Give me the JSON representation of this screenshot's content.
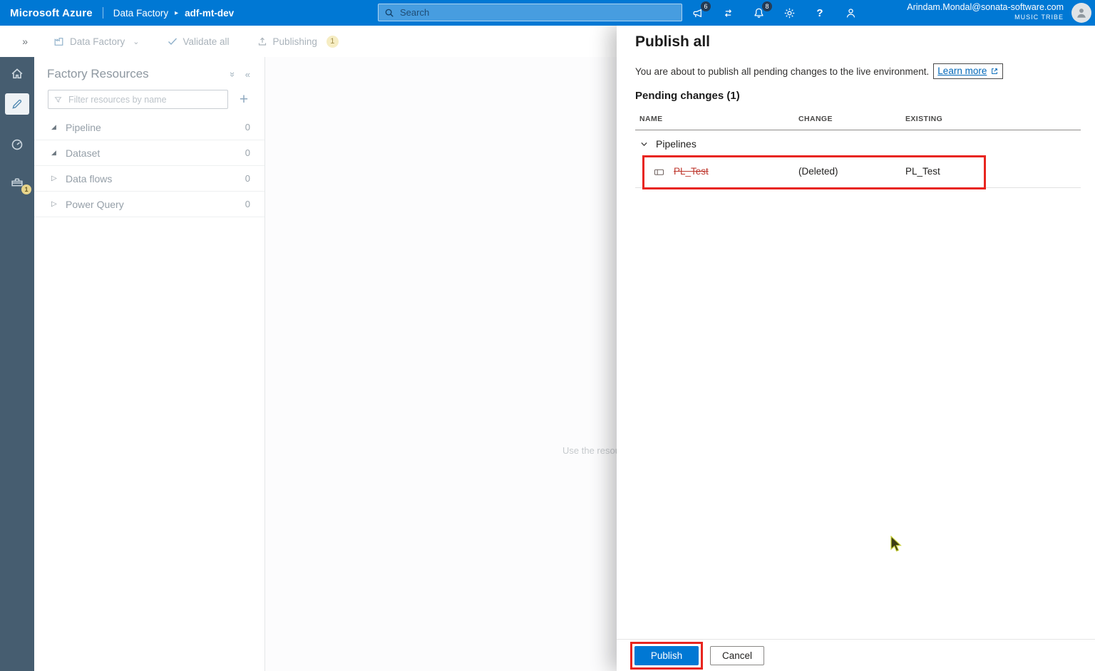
{
  "topbar": {
    "brand": "Microsoft Azure",
    "breadcrumb": {
      "app": "Data Factory",
      "instance": "adf-mt-dev"
    },
    "search": {
      "placeholder": "Search"
    },
    "badges": {
      "announcements": "6",
      "notifications": "8"
    },
    "account": {
      "email": "Arindam.Mondal@sonata-software.com",
      "tenant": "MUSIC TRIBE"
    }
  },
  "sidebar": {
    "manage_badge": "1"
  },
  "toolbar": {
    "data_factory": "Data Factory",
    "validate_all": "Validate all",
    "publishing": "Publishing",
    "publishing_badge": "1"
  },
  "resources": {
    "title": "Factory Resources",
    "filter_placeholder": "Filter resources by name",
    "groups": [
      {
        "label": "Pipeline",
        "count": "0",
        "state": "expanded"
      },
      {
        "label": "Dataset",
        "count": "0",
        "state": "expanded"
      },
      {
        "label": "Data flows",
        "count": "0",
        "state": "collapsed"
      },
      {
        "label": "Power Query",
        "count": "0",
        "state": "collapsed"
      }
    ]
  },
  "canvas": {
    "hint": "Use the resou"
  },
  "publish_panel": {
    "title": "Publish all",
    "description": "You are about to publish all pending changes to the live environment.",
    "learn_more": "Learn more",
    "pending_heading": "Pending changes (1)",
    "columns": [
      "NAME",
      "CHANGE",
      "EXISTING"
    ],
    "group": "Pipelines",
    "rows": [
      {
        "name": "PL_Test",
        "change": "(Deleted)",
        "existing": "PL_Test"
      }
    ],
    "publish": "Publish",
    "cancel": "Cancel"
  },
  "glyphs": {
    "nav_expand": "»",
    "collapse_all": "»",
    "panel_collapse": "«",
    "crumb_sep": "▸",
    "dropdown": "⌄",
    "tree_open": "◢",
    "tree_closed": "▷",
    "plus": "+",
    "help": "?"
  },
  "colors": {
    "azure_blue": "#0078d4",
    "annotation_red": "#e8251f",
    "deleted_text": "#bf3a30",
    "link_blue": "#0067b8"
  }
}
